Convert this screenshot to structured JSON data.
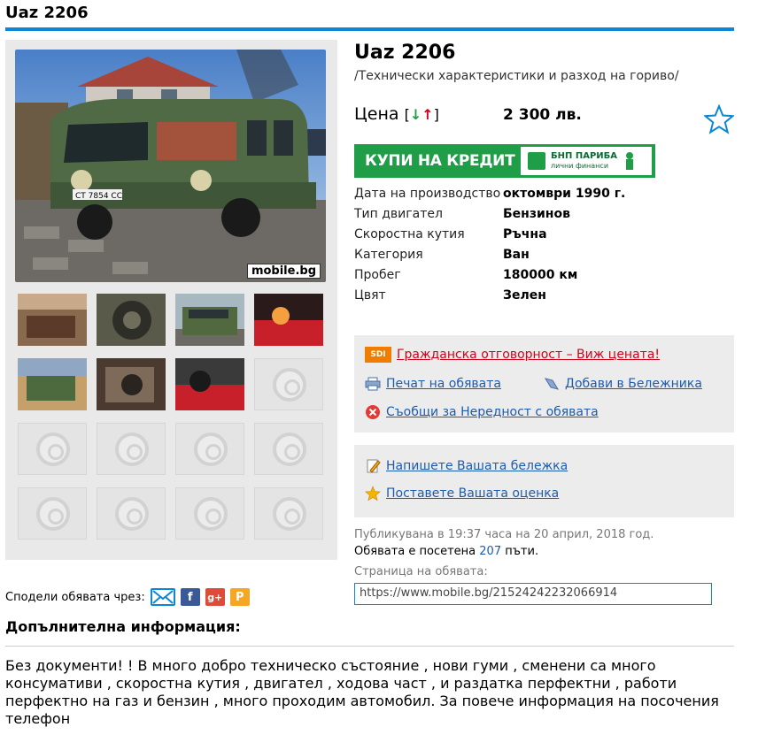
{
  "header": {
    "title": "Uaz 2206"
  },
  "listing": {
    "title": "Uaz 2206",
    "subtitle": "/Технически характеристики и разход на гориво/",
    "price_label": "Цена",
    "price_arrows": "[↓↑]",
    "price": "2 300 лв.",
    "credit_banner": {
      "text": "КУПИ НА КРЕДИТ",
      "bank_name": "БНП ПАРИБА",
      "bank_sub": "лични финанси"
    },
    "specs": [
      {
        "key": "Дата на производство",
        "value": "октомври 1990 г."
      },
      {
        "key": "Тип двигател",
        "value": "Бензинов"
      },
      {
        "key": "Скоростна кутия",
        "value": "Ръчна"
      },
      {
        "key": "Категория",
        "value": "Ван"
      },
      {
        "key": "Пробег",
        "value": "180000 км"
      },
      {
        "key": "Цвят",
        "value": "Зелен"
      }
    ]
  },
  "gallery": {
    "watermark": "mobile.bg"
  },
  "actions": {
    "insurance_badge": "SDI",
    "insurance_link": "Гражданска отговорност – Виж цената!",
    "print_link": "Печат на обявата",
    "notebook_link": "Добави в Бележника",
    "report_link": "Съобщи за Нередност с обявата",
    "note_link": "Напишете Вашата бележка",
    "rate_link": "Поставете Вашата оценка"
  },
  "meta": {
    "published": "Публикувана в 19:37 часа на 20 април, 2018 год.",
    "visited_prefix": "Обявата е посетена",
    "visited_count": "207",
    "visited_suffix": "пъти.",
    "page_label": "Страница на обявата:",
    "url": "https://www.mobile.bg/21524242232066914"
  },
  "share": {
    "label": "Сподели обявата чрез:"
  },
  "extra": {
    "title": "Допълнителна информация:",
    "text": "Без документи! ! В много добро техническо състояние , нови гуми , сменени са много консумативи , скоростна кутия , двигател , ходова част , и раздатка перфектни , работи перфектно на газ и бензин , много проходим автомобил. За повече информация на посочения телефон"
  },
  "colors": {
    "accent": "#0b87d6",
    "link": "#1b5cb0",
    "credit_green": "#1f9d47",
    "alert_red": "#d0021b"
  }
}
